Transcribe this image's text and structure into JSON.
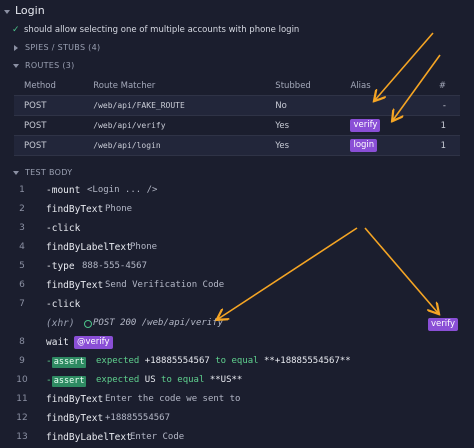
{
  "test": {
    "suite_title": "Login",
    "test_title": "should allow selecting one of multiple accounts with phone login"
  },
  "sections": {
    "spies": "SPIES / STUBS (4)",
    "routes": "ROUTES (3)",
    "test_body": "TEST BODY"
  },
  "routes_table": {
    "headers": [
      "Method",
      "Route Matcher",
      "Stubbed",
      "Alias",
      "#"
    ],
    "rows": [
      {
        "method": "POST",
        "matcher": "/web/api/FAKE_ROUTE",
        "stubbed": "No",
        "alias": "",
        "count": "-"
      },
      {
        "method": "POST",
        "matcher": "/web/api/verify",
        "stubbed": "Yes",
        "alias": "verify",
        "count": "1"
      },
      {
        "method": "POST",
        "matcher": "/web/api/login",
        "stubbed": "Yes",
        "alias": "login",
        "count": "1"
      }
    ]
  },
  "commands": [
    {
      "num": "1",
      "name": "-mount",
      "args": "<Login ... />"
    },
    {
      "num": "2",
      "name": "findByText",
      "args": "Phone"
    },
    {
      "num": "3",
      "name": "-click",
      "args": ""
    },
    {
      "num": "4",
      "name": "findByLabelText",
      "args": "Phone"
    },
    {
      "num": "5",
      "name": "-type",
      "args": "888-555-4567"
    },
    {
      "num": "6",
      "name": "findByText",
      "args": "Send Verification Code"
    },
    {
      "num": "7",
      "name": "-click",
      "args": ""
    },
    {
      "num": "",
      "name": "(xhr)",
      "args": "POST 200 /web/api/verify",
      "alias": "verify"
    },
    {
      "num": "8",
      "name": "wait",
      "args": "@verify"
    },
    {
      "num": "9",
      "name": "-assert",
      "args": "expected +18885554567 to equal **+18885554567**"
    },
    {
      "num": "10",
      "name": "-assert",
      "args": "expected US to equal **US**"
    },
    {
      "num": "11",
      "name": "findByText",
      "args": "Enter the code we sent to"
    },
    {
      "num": "12",
      "name": "findByText",
      "args": "+18885554567"
    },
    {
      "num": "13",
      "name": "findByLabelText",
      "args": "Enter Code"
    }
  ],
  "assert_texts": {
    "a9": {
      "expected": "expected",
      "value": "+18885554567",
      "to_equal": "to equal",
      "target": "**+18885554567**"
    },
    "a10": {
      "expected": "expected",
      "value": "US",
      "to_equal": "to equal",
      "target": "**US**"
    }
  },
  "colors": {
    "background": "#1b1e2e",
    "alias_purple": "#8a4fd6",
    "assert_green": "#2e8a62",
    "annotation_orange": "#f5a524"
  },
  "icons": {
    "check": "check-icon",
    "xhr_status": "circle-icon"
  }
}
